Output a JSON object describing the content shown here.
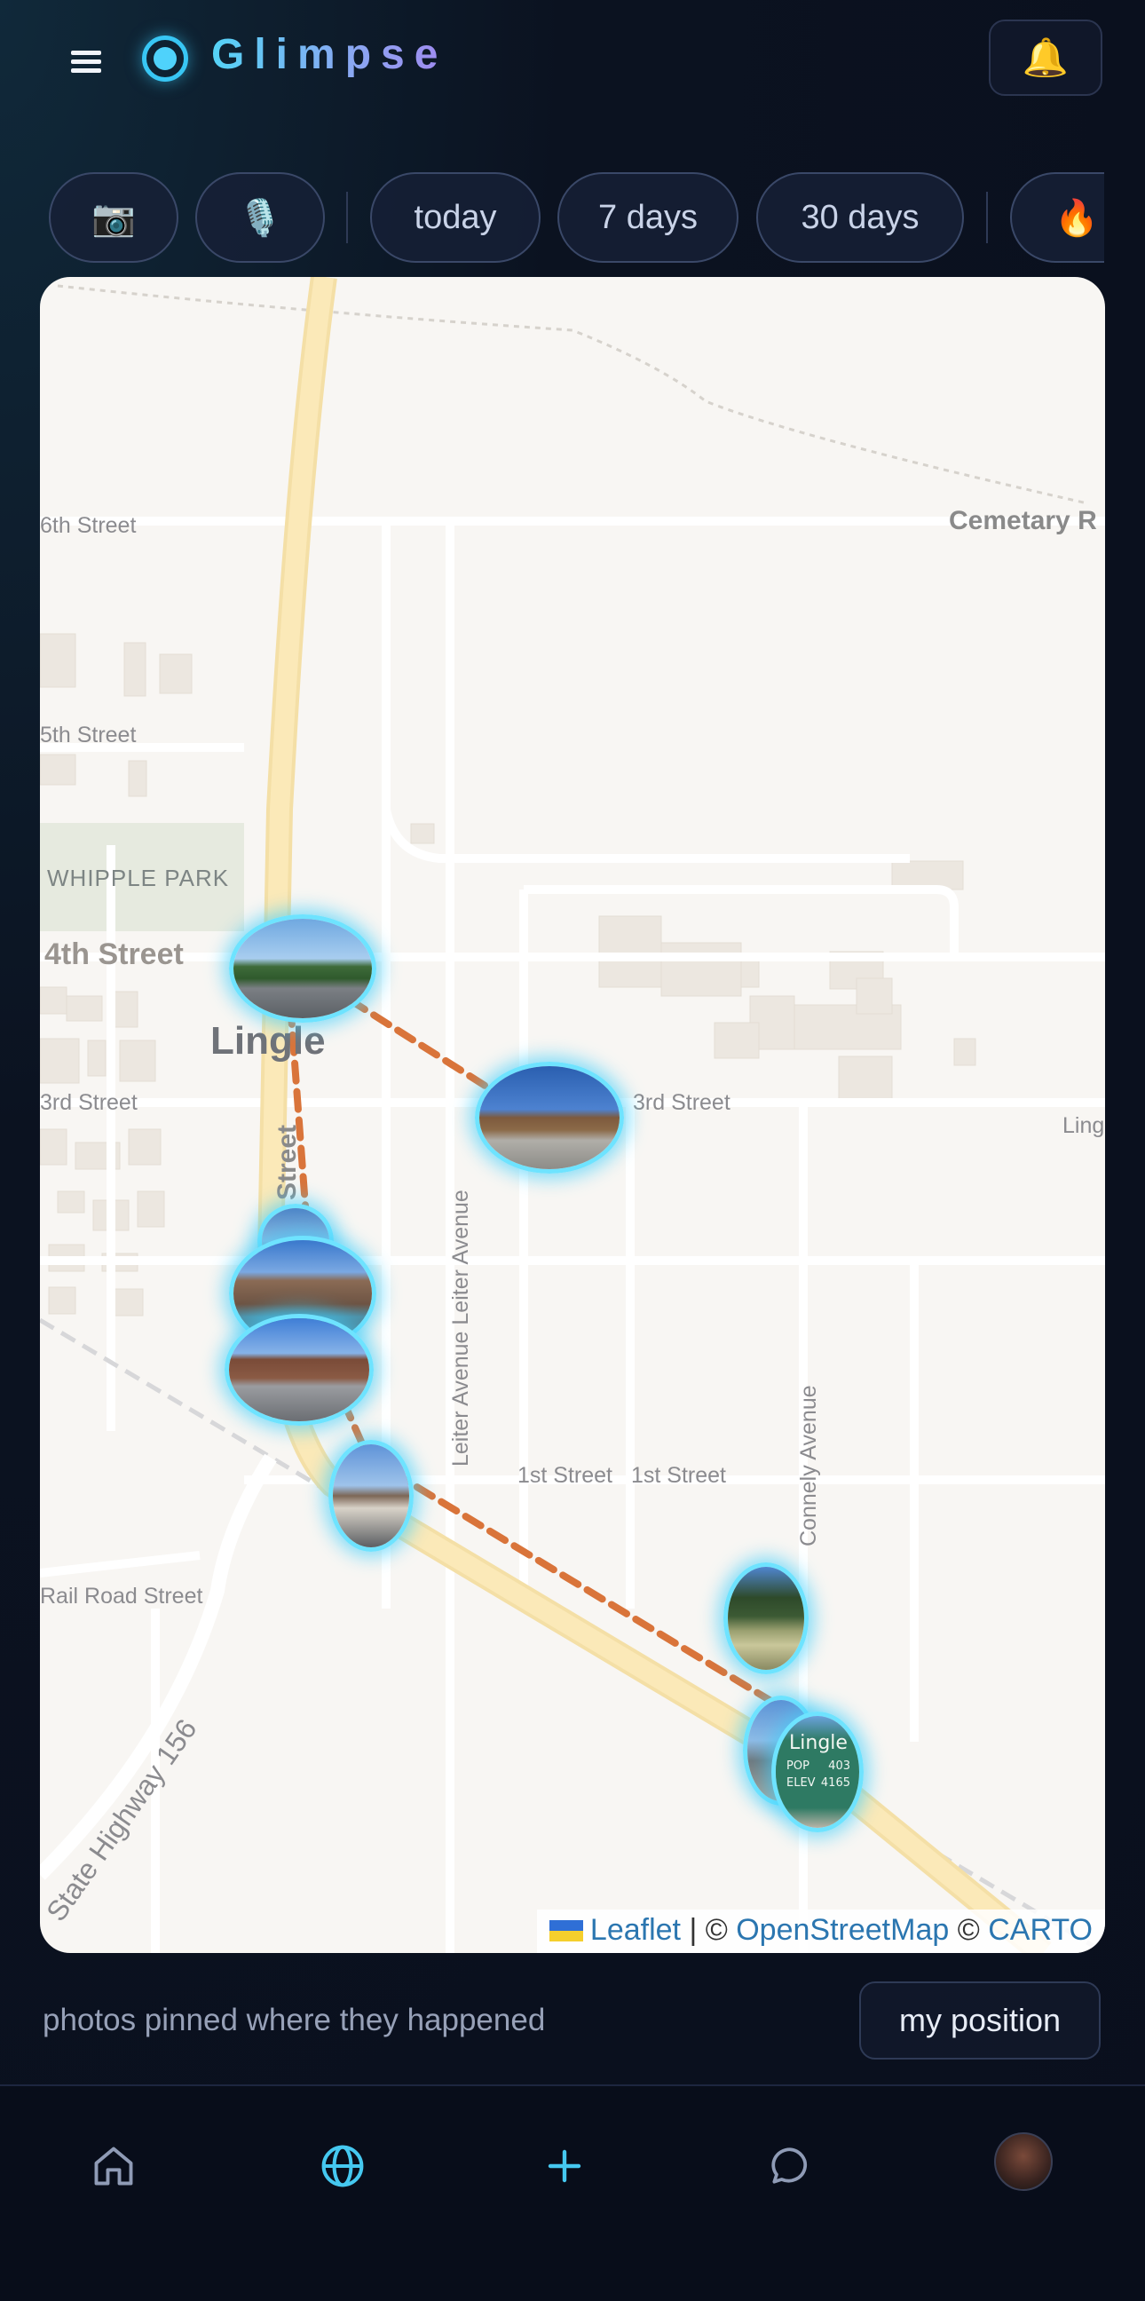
{
  "app": {
    "name": "Glimpse",
    "accent": "#38c6f4"
  },
  "header": {
    "menu_icon": "hamburger-icon",
    "bell_icon": "bell-icon",
    "bell_glyph": "🔔"
  },
  "filters": {
    "camera_glyph": "📷",
    "mic_glyph": "🎙️",
    "ranges": [
      "today",
      "7 days",
      "30 days"
    ],
    "fire_glyph": "🔥"
  },
  "map": {
    "town": "Lingle",
    "park": "WHIPPLE PARK",
    "streets": {
      "sixth": "6th Street",
      "cemetary": "Cemetary R",
      "fifth": "5th Street",
      "fourth": "4th Street",
      "third_w": "3rd Street",
      "third_e": "3rd Street",
      "lingle_rd": "Lingle R",
      "first_a": "1st Street",
      "first_b": "1st Street",
      "rail": "Rail Road Street",
      "hwy": "State Highway 156",
      "leiter": "Leiter Avenue Leiter Avenue",
      "connely": "Connely Avenue",
      "main": "Street"
    },
    "sign": {
      "name": "Lingle",
      "pop_label": "POP",
      "pop": "403",
      "elev_label": "ELEV",
      "elev": "4165"
    },
    "attribution": {
      "leaflet": "Leaflet",
      "sep": " | © ",
      "osm": "OpenStreetMap",
      "sep2": " © ",
      "carto": "CARTO"
    },
    "route_color": "#d9743a",
    "pin_glow": "#6ee3ff"
  },
  "caption": "photos pinned where they happened",
  "position_button": "my position",
  "nav": {
    "items": [
      "home-icon",
      "globe-icon",
      "plus-icon",
      "chat-icon",
      "avatar"
    ],
    "active": "globe-icon"
  }
}
